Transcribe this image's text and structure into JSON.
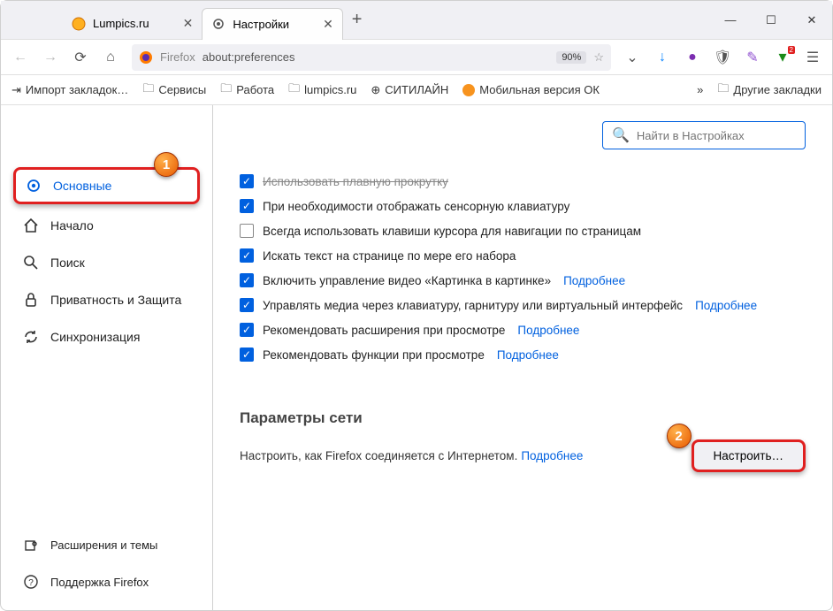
{
  "tabs": [
    {
      "label": "Lumpics.ru",
      "iconColor": "#f7a400"
    },
    {
      "label": "Настройки"
    }
  ],
  "urlbar": {
    "identity": "Firefox",
    "address": "about:preferences",
    "zoom": "90%"
  },
  "bookmarks": {
    "b0": "Импорт закладок…",
    "b1": "Сервисы",
    "b2": "Работа",
    "b3": "lumpics.ru",
    "b4": "СИТИЛАЙН",
    "b5": "Мобильная версия ОК",
    "other": "Другие закладки"
  },
  "search": {
    "placeholder": "Найти в Настройках"
  },
  "sidebar": {
    "i0": "Основные",
    "i1": "Начало",
    "i2": "Поиск",
    "i3": "Приватность и Защита",
    "i4": "Синхронизация",
    "f0": "Расширения и темы",
    "f1": "Поддержка Firefox"
  },
  "opts": {
    "o0": "Использовать плавную прокрутку",
    "o1": "При необходимости отображать сенсорную клавиатуру",
    "o2": "Всегда использовать клавиши курсора для навигации по страницам",
    "o3": "Искать текст на странице по мере его набора",
    "o4": "Включить управление видео «Картинка в картинке»",
    "o5": "Управлять медиа через клавиатуру, гарнитуру или виртуальный интерфейс",
    "o6": "Рекомендовать расширения при просмотре",
    "o7": "Рекомендовать функции при просмотре",
    "more": "Подробнее"
  },
  "net": {
    "heading": "Параметры сети",
    "text": "Настроить, как Firefox соединяется с Интернетом.",
    "more": "Подробнее",
    "button": "Настроить…"
  },
  "markers": {
    "m1": "1",
    "m2": "2"
  }
}
